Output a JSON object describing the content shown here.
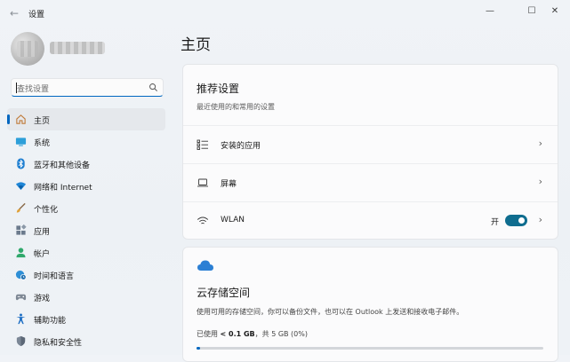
{
  "window": {
    "title": "设置",
    "minimize_glyph": "—",
    "maximize_glyph": "☐",
    "close_glyph": "✕",
    "back_glyph": "←"
  },
  "search": {
    "placeholder": "查找设置"
  },
  "sidebar": {
    "items": [
      {
        "label": "主页",
        "icon": "home-icon",
        "active": true
      },
      {
        "label": "系统",
        "icon": "system-display-icon"
      },
      {
        "label": "蓝牙和其他设备",
        "icon": "bluetooth-icon"
      },
      {
        "label": "网络和 Internet",
        "icon": "wifi-icon"
      },
      {
        "label": "个性化",
        "icon": "brush-icon"
      },
      {
        "label": "应用",
        "icon": "apps-icon"
      },
      {
        "label": "帐户",
        "icon": "account-icon"
      },
      {
        "label": "时间和语言",
        "icon": "globe-clock-icon"
      },
      {
        "label": "游戏",
        "icon": "gamepad-icon"
      },
      {
        "label": "辅助功能",
        "icon": "accessibility-icon"
      },
      {
        "label": "隐私和安全性",
        "icon": "shield-icon"
      }
    ]
  },
  "main": {
    "title": "主页",
    "recommended": {
      "title": "推荐设置",
      "subtitle": "最近使用的和常用的设置",
      "rows": [
        {
          "label": "安装的应用",
          "icon": "installed-apps-icon"
        },
        {
          "label": "屏幕",
          "icon": "laptop-icon"
        },
        {
          "label": "WLAN",
          "icon": "wifi-icon",
          "toggle_label": "开",
          "toggle_on": true
        }
      ]
    },
    "cloud": {
      "title": "云存储空间",
      "description": "使用可用的存储空间，你可以备份文件，也可以在 Outlook 上发送和接收电子邮件。",
      "used_prefix": "已使用",
      "used_value": "< 0.1 GB",
      "used_suffix": "，共 5 GB (0%)",
      "usage_fraction": 0.01
    }
  },
  "colors": {
    "accent": "#0067c0",
    "toggle": "#0f6d8f"
  }
}
